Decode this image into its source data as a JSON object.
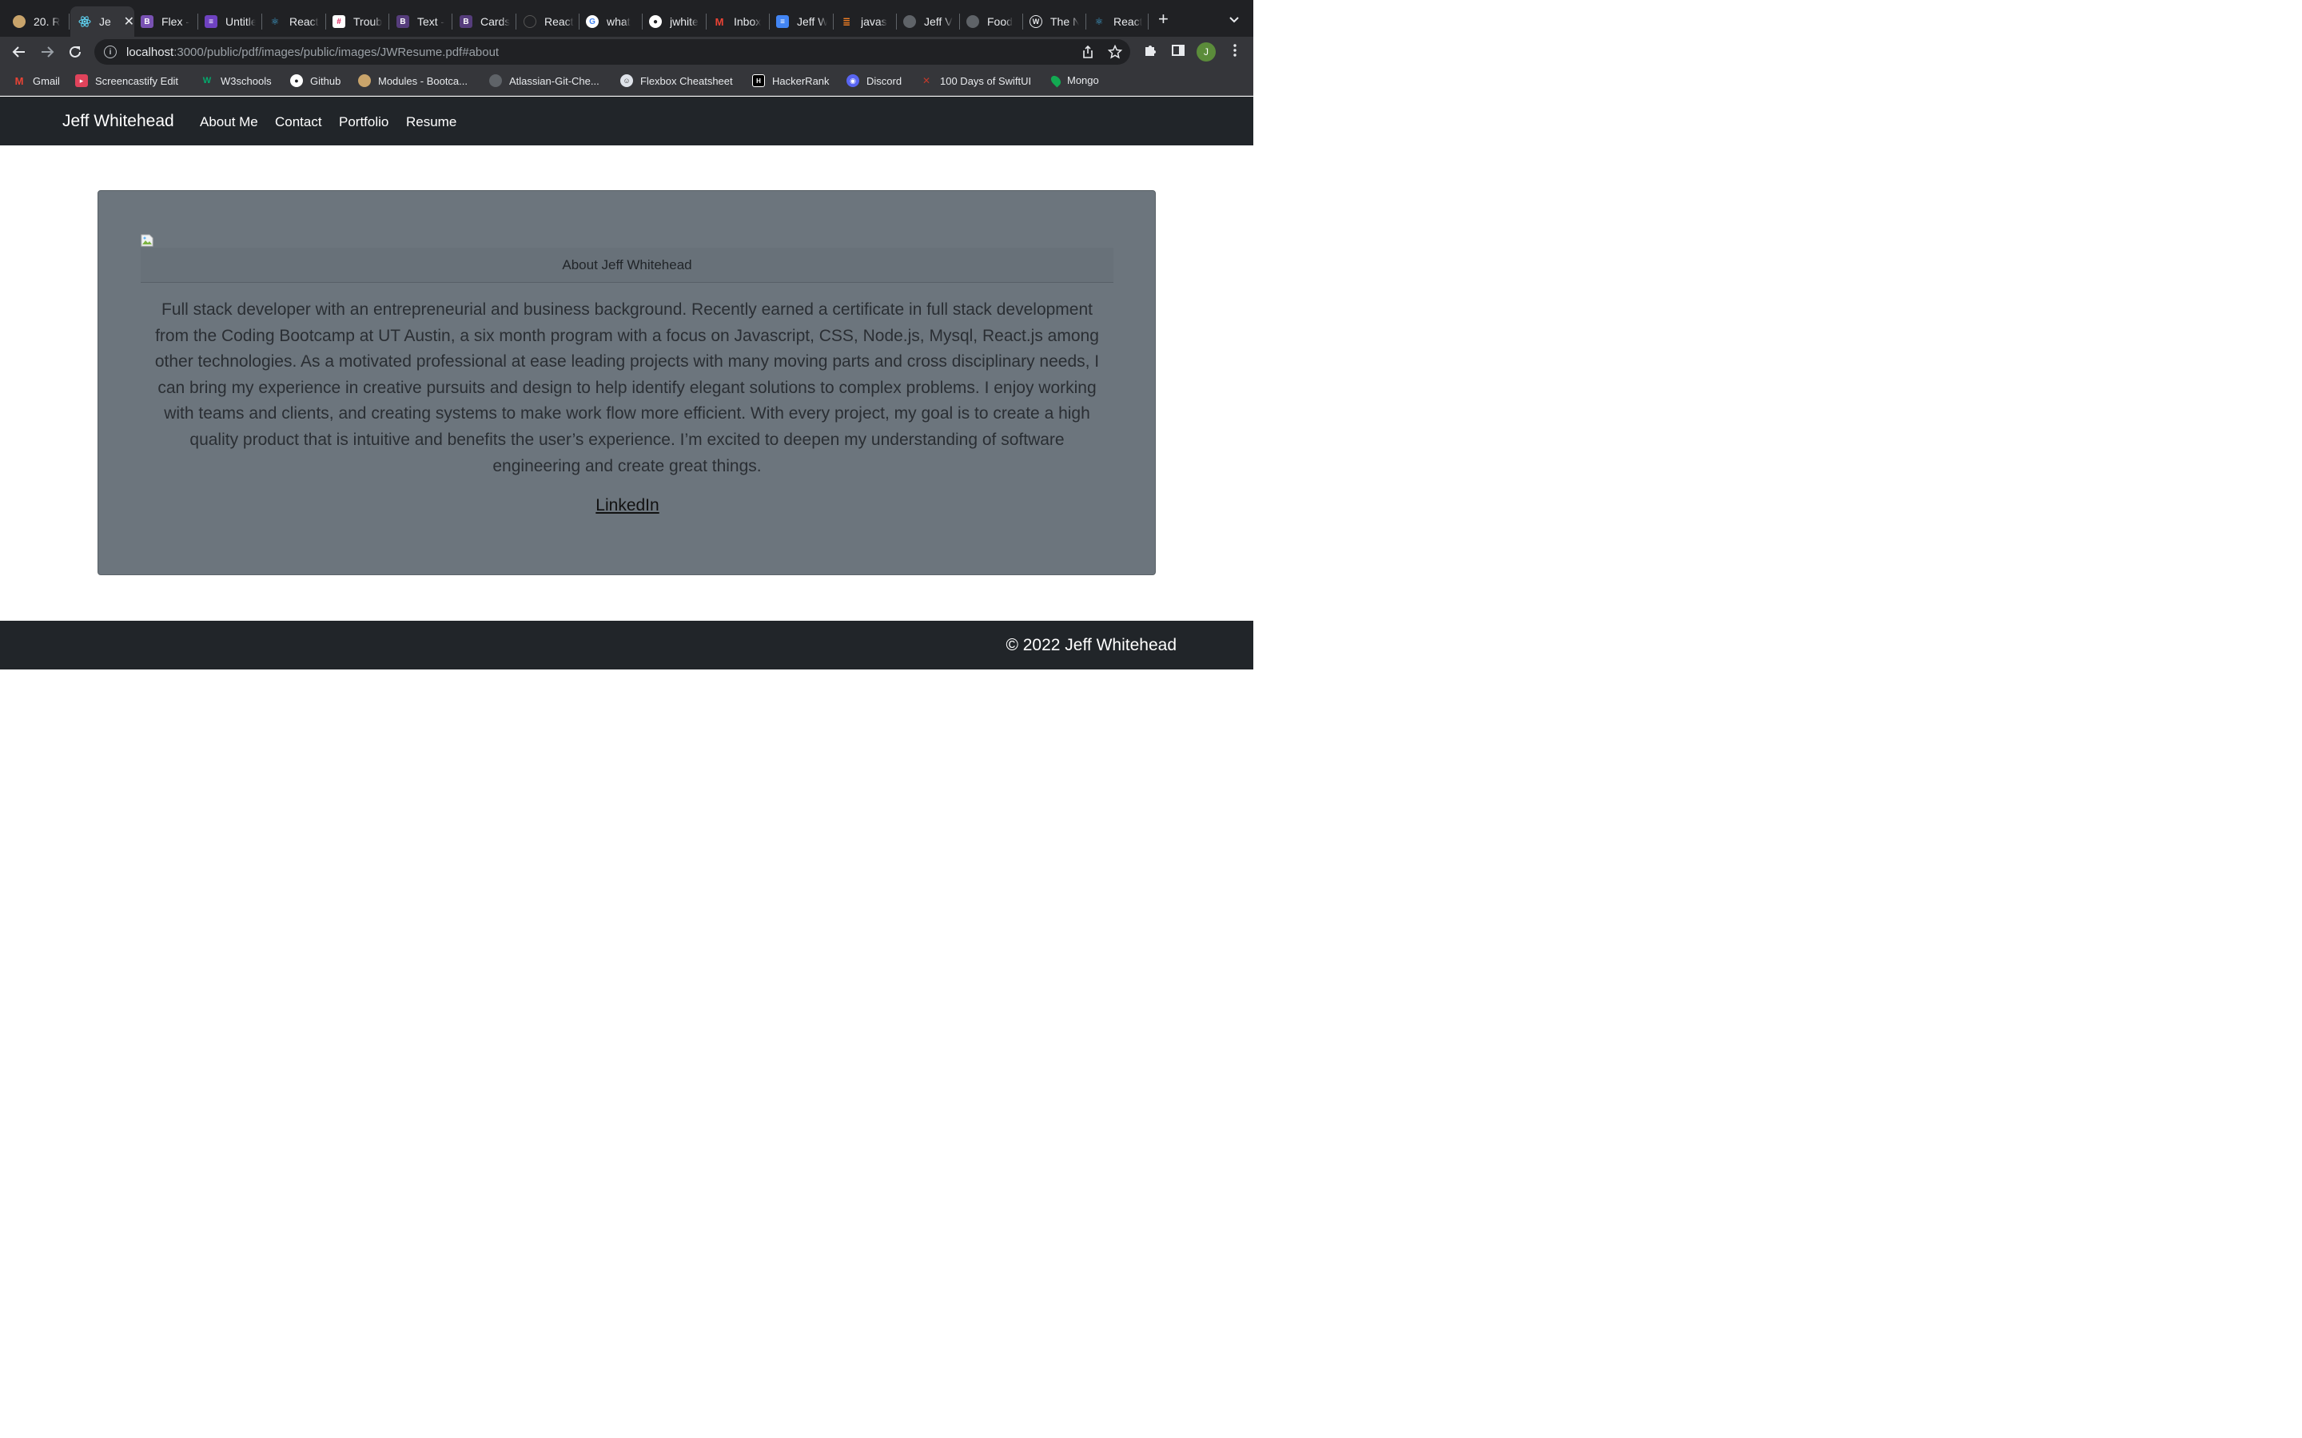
{
  "browser": {
    "tabs": [
      {
        "label": "20. R",
        "icon": "beige-circle",
        "color": "#c9a46b"
      },
      {
        "label": "Je",
        "icon": "react-icon",
        "color": "#61dafb",
        "active": true
      },
      {
        "label": "Flex -",
        "icon": "bootstrap-icon",
        "color": "#7952b3"
      },
      {
        "label": "Untitle",
        "icon": "list-icon",
        "color": "#6f42c1"
      },
      {
        "label": "React",
        "icon": "react-bootstrap-icon",
        "color": "#41a6d6"
      },
      {
        "label": "Troub",
        "icon": "slack-icon",
        "color": "#e01e5a"
      },
      {
        "label": "Text -",
        "icon": "bootstrap-icon",
        "color": "#563d7c"
      },
      {
        "label": "Cards",
        "icon": "bootstrap-icon",
        "color": "#563d7c"
      },
      {
        "label": "React",
        "icon": "hex-icon",
        "color": "#555"
      },
      {
        "label": "what",
        "icon": "google-icon",
        "color": "#ffffff"
      },
      {
        "label": "jwhite",
        "icon": "github-icon",
        "color": "#ffffff"
      },
      {
        "label": "Inbox",
        "icon": "gmail-icon",
        "color": "#ea4335"
      },
      {
        "label": "Jeff W",
        "icon": "docs-icon",
        "color": "#4285f4"
      },
      {
        "label": "javas",
        "icon": "stackoverflow-icon",
        "color": "#f48024"
      },
      {
        "label": "Jeff V",
        "icon": "globe-icon",
        "color": "#9aa0a6"
      },
      {
        "label": "Food",
        "icon": "globe-icon",
        "color": "#9aa0a6"
      },
      {
        "label": "The N",
        "icon": "wordpress-icon",
        "color": "#e8eaed"
      },
      {
        "label": "React",
        "icon": "react-bootstrap-icon",
        "color": "#41a6d6"
      }
    ],
    "url_host": "localhost",
    "url_rest": ":3000/public/pdf/images/public/images/JWResume.pdf#about",
    "profile_initial": "J",
    "bookmarks": [
      {
        "label": "Gmail",
        "icon": "gmail-icon",
        "color": "#ea4335"
      },
      {
        "label": "Screencastify Edit",
        "icon": "screencastify-icon",
        "color": "#e0435b"
      },
      {
        "label": "W3schools",
        "icon": "w3schools-icon",
        "color": "#04aa6d"
      },
      {
        "label": "Github",
        "icon": "github-icon",
        "color": "#ffffff"
      },
      {
        "label": "Modules - Bootca...",
        "icon": "bootcamp-icon",
        "color": "#c9a46b"
      },
      {
        "label": "Atlassian-Git-Che...",
        "icon": "globe-icon",
        "color": "#9aa0a6"
      },
      {
        "label": "Flexbox Cheatsheet",
        "icon": "flexbox-icon",
        "color": "#dfe3ea"
      },
      {
        "label": "HackerRank",
        "icon": "hackerrank-icon",
        "color": "#000000"
      },
      {
        "label": "Discord",
        "icon": "discord-icon",
        "color": "#5865f2"
      },
      {
        "label": "100 Days of SwiftUI",
        "icon": "swift-icon",
        "color": "#c0392b"
      },
      {
        "label": "Mongo",
        "icon": "mongo-leaf-icon",
        "color": "#13aa52"
      }
    ]
  },
  "site": {
    "brand": "Jeff Whitehead",
    "nav": [
      "About Me",
      "Contact",
      "Portfolio",
      "Resume"
    ],
    "about": {
      "header": "About Jeff Whitehead",
      "bio": "Full stack developer with an entrepreneurial and business background. Recently earned a certificate in full stack development from the Coding Bootcamp at UT Austin, a six month program with a focus on Javascript, CSS, Node.js, Mysql, React.js among other technologies. As a motivated professional at ease leading projects with many moving parts and cross disciplinary needs, I can bring my experience in creative pursuits and design to help identify elegant solutions to complex problems. I enjoy working with teams and clients, and creating systems to make work flow more efficient. With every project, my goal is to create a high quality product that is intuitive and benefits the user’s experience. I’m excited to deepen my understanding of software engineering and create great things.",
      "link_label": "LinkedIn"
    },
    "footer": "© 2022 Jeff Whitehead"
  }
}
